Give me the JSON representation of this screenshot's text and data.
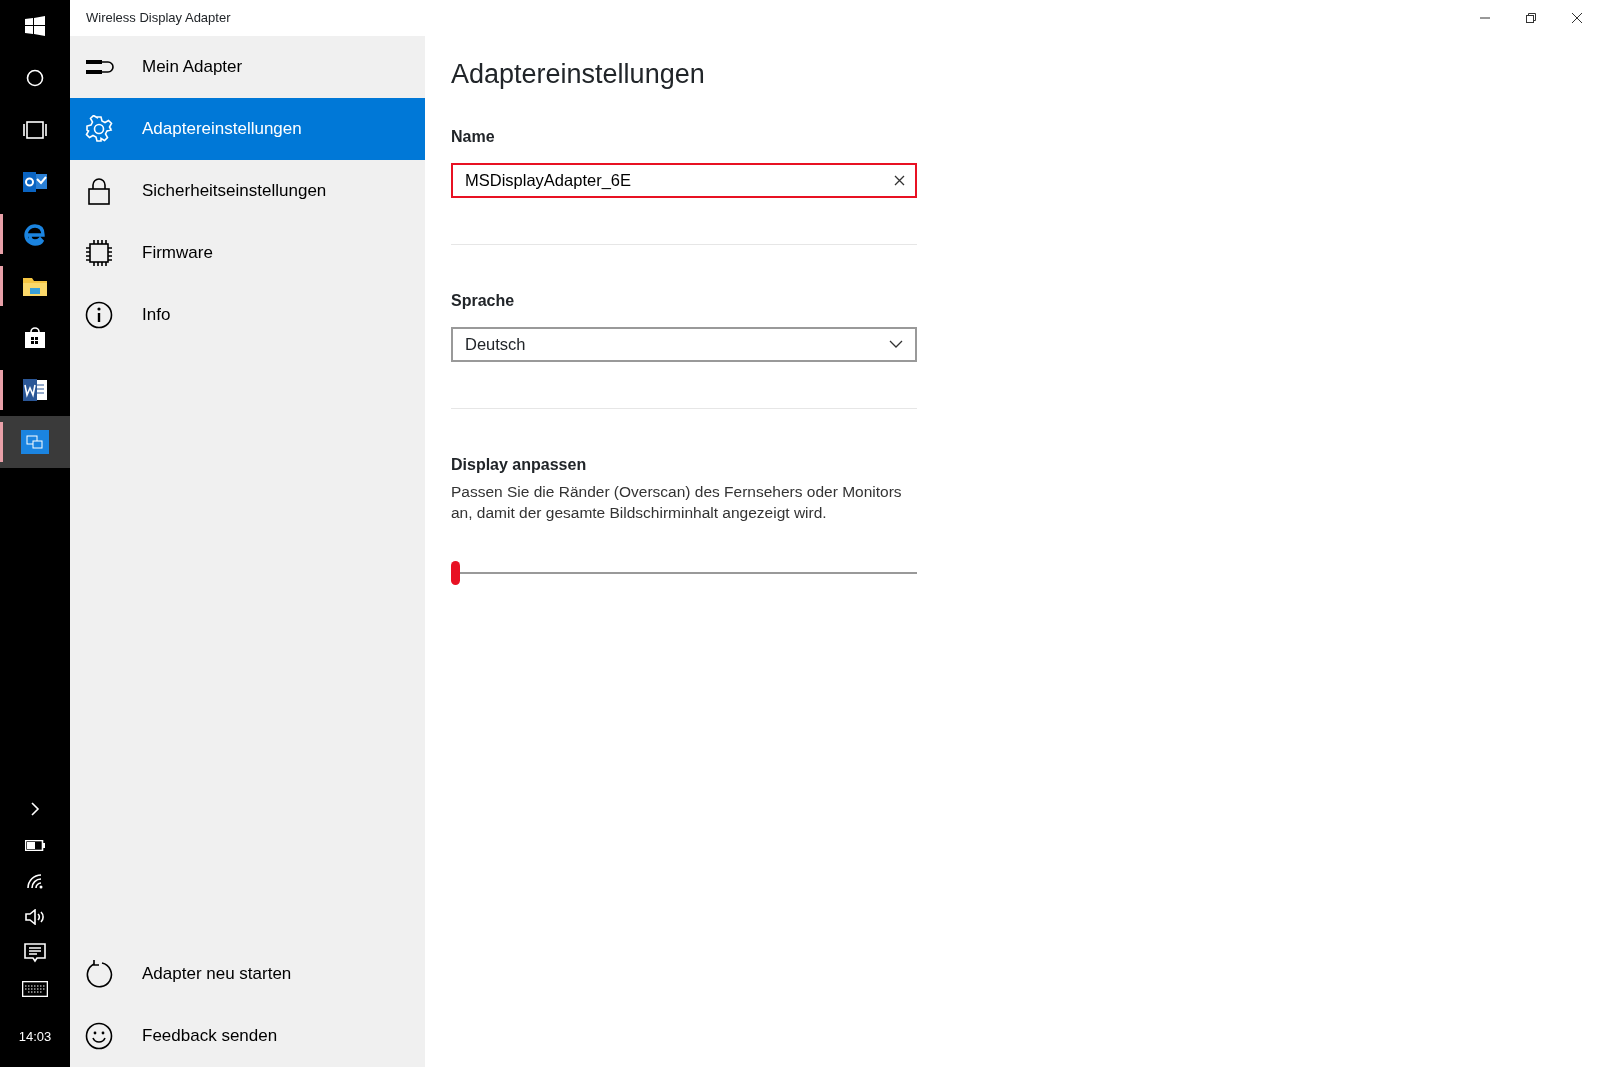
{
  "window": {
    "title": "Wireless Display Adapter"
  },
  "taskbar": {
    "apps": [
      {
        "kind": "start",
        "running": false,
        "selected": false
      },
      {
        "kind": "search",
        "running": false,
        "selected": false
      },
      {
        "kind": "taskview",
        "running": false,
        "selected": false
      },
      {
        "kind": "mail",
        "running": false,
        "selected": false
      },
      {
        "kind": "browser",
        "running": true,
        "selected": false
      },
      {
        "kind": "folder",
        "running": true,
        "selected": false
      },
      {
        "kind": "store",
        "running": false,
        "selected": false
      },
      {
        "kind": "document",
        "running": true,
        "selected": false
      },
      {
        "kind": "display",
        "running": true,
        "selected": true
      }
    ],
    "clock": "14:03"
  },
  "nav": {
    "items": [
      {
        "kind": "adapter",
        "label": "Mein Adapter",
        "selected": false
      },
      {
        "kind": "gear",
        "label": "Adaptereinstellungen",
        "selected": true
      },
      {
        "kind": "lock",
        "label": "Sicherheitseinstellungen",
        "selected": false
      },
      {
        "kind": "chip",
        "label": "Firmware",
        "selected": false
      },
      {
        "kind": "info",
        "label": "Info",
        "selected": false
      }
    ],
    "footer_items": [
      {
        "kind": "restart",
        "label": "Adapter neu starten"
      },
      {
        "kind": "smiley",
        "label": "Feedback senden"
      }
    ]
  },
  "page": {
    "heading": "Adaptereinstellungen",
    "name_field": {
      "label": "Name",
      "value": "MSDisplayAdapter_6E",
      "focused": true
    },
    "language": {
      "label": "Sprache",
      "value": "Deutsch"
    },
    "display": {
      "label": "Display anpassen",
      "description": "Passen Sie die Ränder (Overscan) des Fernsehers oder Monitors an, damit der gesamte Bildschirminhalt angezeigt wird.",
      "slider": {
        "level": 0
      }
    }
  }
}
